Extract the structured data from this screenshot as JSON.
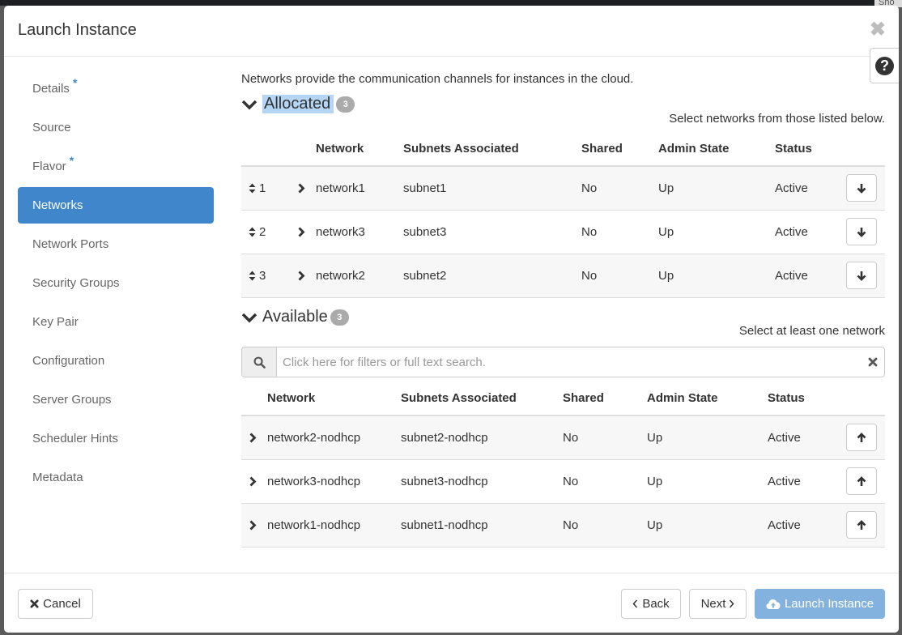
{
  "backdrop": {
    "tip_text": "Sho"
  },
  "modal": {
    "title": "Launch Instance",
    "close_icon": "close-icon",
    "help_icon": "question-circle-icon",
    "help_label": "?"
  },
  "sidebar": {
    "items": [
      {
        "label": "Details",
        "required": true,
        "active": false
      },
      {
        "label": "Source",
        "required": false,
        "active": false
      },
      {
        "label": "Flavor",
        "required": true,
        "active": false
      },
      {
        "label": "Networks",
        "required": false,
        "active": true
      },
      {
        "label": "Network Ports",
        "required": false,
        "active": false
      },
      {
        "label": "Security Groups",
        "required": false,
        "active": false
      },
      {
        "label": "Key Pair",
        "required": false,
        "active": false
      },
      {
        "label": "Configuration",
        "required": false,
        "active": false
      },
      {
        "label": "Server Groups",
        "required": false,
        "active": false
      },
      {
        "label": "Scheduler Hints",
        "required": false,
        "active": false
      },
      {
        "label": "Metadata",
        "required": false,
        "active": false
      }
    ],
    "required_marker": "*"
  },
  "networks": {
    "intro": "Networks provide the communication channels for instances in the cloud.",
    "allocated": {
      "title": "Allocated",
      "count": "3",
      "hint": "Select networks from those listed below.",
      "columns": [
        "Network",
        "Subnets Associated",
        "Shared",
        "Admin State",
        "Status"
      ],
      "rows": [
        {
          "order": "1",
          "network": "network1",
          "subnets": "subnet1",
          "shared": "No",
          "admin_state": "Up",
          "status": "Active"
        },
        {
          "order": "2",
          "network": "network3",
          "subnets": "subnet3",
          "shared": "No",
          "admin_state": "Up",
          "status": "Active"
        },
        {
          "order": "3",
          "network": "network2",
          "subnets": "subnet2",
          "shared": "No",
          "admin_state": "Up",
          "status": "Active"
        }
      ]
    },
    "available": {
      "title": "Available",
      "count": "3",
      "hint": "Select at least one network",
      "search_placeholder": "Click here for filters or full text search.",
      "search_value": "",
      "columns": [
        "Network",
        "Subnets Associated",
        "Shared",
        "Admin State",
        "Status"
      ],
      "rows": [
        {
          "network": "network2-nodhcp",
          "subnets": "subnet2-nodhcp",
          "shared": "No",
          "admin_state": "Up",
          "status": "Active"
        },
        {
          "network": "network3-nodhcp",
          "subnets": "subnet3-nodhcp",
          "shared": "No",
          "admin_state": "Up",
          "status": "Active"
        },
        {
          "network": "network1-nodhcp",
          "subnets": "subnet1-nodhcp",
          "shared": "No",
          "admin_state": "Up",
          "status": "Active"
        }
      ]
    }
  },
  "footer": {
    "cancel_label": "Cancel",
    "back_label": "Back",
    "next_label": "Next",
    "launch_label": "Launch Instance"
  },
  "colors": {
    "accent": "#3f87ca",
    "primary_disabled": "#84b2df",
    "selection_highlight": "#b5d5f5",
    "badge": "#aaaaaa"
  }
}
